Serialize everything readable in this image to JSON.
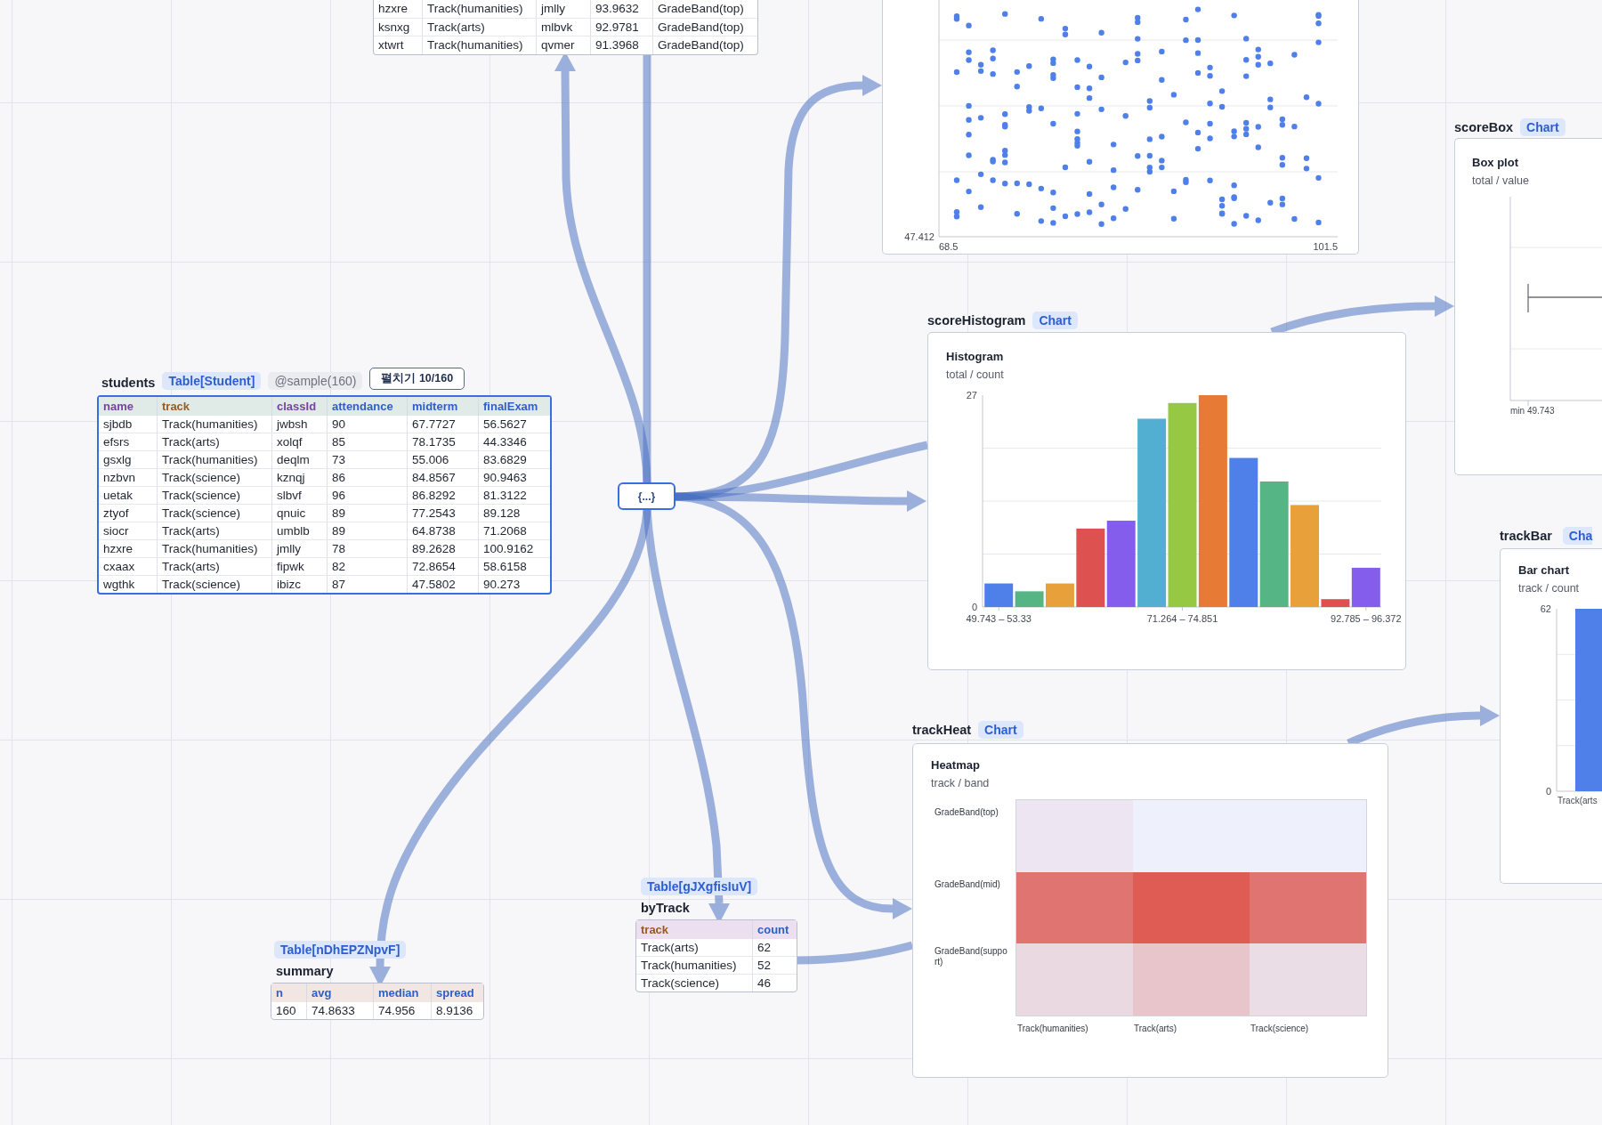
{
  "canvas": {
    "top_table": {
      "selected": false,
      "rows": [
        [
          "hzxre",
          "Track(humanities)",
          "jmlly",
          "93.9632",
          "GradeBand(top)"
        ],
        [
          "ksnxg",
          "Track(arts)",
          "mlbvk",
          "92.9781",
          "GradeBand(top)"
        ],
        [
          "xtwrt",
          "Track(humanities)",
          "qvmer",
          "91.3968",
          "GradeBand(top)"
        ]
      ]
    },
    "scatter_chart": {
      "y_min_label": "47.412",
      "x_min_label": "68.5",
      "x_max_label": "101.5"
    },
    "students": {
      "title": "students",
      "type_badge": "Table[Student]",
      "sample_badge": "@sample(160)",
      "expand_button": "펼치기 10/160",
      "selected": true,
      "columns": [
        {
          "label": "name",
          "kind": "string"
        },
        {
          "label": "track",
          "kind": "enum"
        },
        {
          "label": "classId",
          "kind": "string"
        },
        {
          "label": "attendance",
          "kind": "number"
        },
        {
          "label": "midterm",
          "kind": "number"
        },
        {
          "label": "finalExam",
          "kind": "number"
        }
      ],
      "rows": [
        [
          "sjbdb",
          "Track(humanities)",
          "jwbsh",
          "90",
          "67.7727",
          "56.5627"
        ],
        [
          "efsrs",
          "Track(arts)",
          "xolqf",
          "85",
          "78.1735",
          "44.3346"
        ],
        [
          "gsxlg",
          "Track(humanities)",
          "deqlm",
          "73",
          "55.006",
          "83.6829"
        ],
        [
          "nzbvn",
          "Track(science)",
          "kznqj",
          "86",
          "84.8567",
          "90.9463"
        ],
        [
          "uetak",
          "Track(science)",
          "slbvf",
          "96",
          "86.8292",
          "81.3122"
        ],
        [
          "ztyof",
          "Track(science)",
          "qnuic",
          "89",
          "77.2543",
          "89.128"
        ],
        [
          "siocr",
          "Track(arts)",
          "umblb",
          "89",
          "64.8738",
          "71.2068"
        ],
        [
          "hzxre",
          "Track(humanities)",
          "jmlly",
          "78",
          "89.2628",
          "100.9162"
        ],
        [
          "cxaax",
          "Track(arts)",
          "fipwk",
          "82",
          "72.8654",
          "58.6158"
        ],
        [
          "wgthk",
          "Track(science)",
          "ibizc",
          "87",
          "47.5802",
          "90.273"
        ]
      ]
    },
    "hub": {
      "label": "{...}"
    },
    "score_histogram": {
      "title": "scoreHistogram",
      "type_badge": "Chart",
      "subtitle": "total / count",
      "chart_data": {
        "type": "bar",
        "title": "Histogram",
        "categories": [
          "49.743 – 53.33",
          null,
          null,
          null,
          null,
          null,
          "71.264 – 74.851",
          null,
          null,
          null,
          null,
          null,
          "92.785 – 96.372"
        ],
        "series": [
          {
            "color": "#4f7fe9",
            "values": [
              3,
              null,
              null,
              null,
              null,
              null,
              null,
              null,
              19,
              null,
              null,
              null,
              null
            ]
          },
          {
            "color": "#55b585",
            "values": [
              null,
              2,
              null,
              null,
              null,
              null,
              null,
              null,
              null,
              16,
              null,
              null,
              null
            ]
          },
          {
            "color": "#e8a13a",
            "values": [
              null,
              null,
              3,
              null,
              null,
              null,
              null,
              null,
              null,
              null,
              13,
              null,
              null
            ]
          },
          {
            "color": "#dd5250",
            "values": [
              null,
              null,
              null,
              10,
              null,
              null,
              null,
              null,
              null,
              null,
              null,
              1,
              null
            ]
          },
          {
            "color": "#855ded",
            "values": [
              null,
              null,
              null,
              null,
              11,
              null,
              null,
              null,
              null,
              null,
              null,
              null,
              5
            ]
          },
          {
            "color": "#52afd2",
            "values": [
              null,
              null,
              null,
              null,
              null,
              24,
              null,
              null,
              null,
              null,
              null,
              null,
              null
            ]
          },
          {
            "color": "#96c843",
            "values": [
              null,
              null,
              null,
              null,
              null,
              null,
              26,
              null,
              null,
              null,
              null,
              null,
              null
            ]
          },
          {
            "color": "#e77a35",
            "values": [
              null,
              null,
              null,
              null,
              null,
              null,
              null,
              27,
              null,
              null,
              null,
              null,
              null
            ]
          }
        ],
        "ylim": [
          0,
          27
        ],
        "yticks": [
          0,
          27
        ]
      }
    },
    "score_box": {
      "title": "scoreBox",
      "type_badge": "Chart",
      "chart_title": "Box plot",
      "subtitle": "total / value",
      "min_label": "min 49.743"
    },
    "track_bar": {
      "title": "trackBar",
      "type_badge": "Cha",
      "subtitle": "track / count",
      "chart_data": {
        "type": "bar",
        "title": "Bar chart",
        "categories": [
          "Track(arts"
        ],
        "values": [
          62
        ],
        "ylim": [
          0,
          62
        ],
        "yticks": [
          0,
          62
        ]
      }
    },
    "track_heat": {
      "title": "trackHeat",
      "type_badge": "Chart",
      "chart_title": "Heatmap",
      "subtitle": "track / band",
      "row_labels": [
        "GradeBand(top)",
        "GradeBand(mid)",
        "GradeBand(support)"
      ],
      "column_labels": [
        "Track(humanities)",
        "Track(arts)",
        "Track(science)"
      ],
      "cells": [
        [
          {
            "color": "#ede6f2"
          },
          {
            "color": "#eef0fb"
          },
          {
            "color": "#eef0fb"
          }
        ],
        [
          {
            "color": "#e07470"
          },
          {
            "color": "#df5c55"
          },
          {
            "color": "#e07470"
          }
        ],
        [
          {
            "color": "#ead9e1"
          },
          {
            "color": "#e7c5cb"
          },
          {
            "color": "#eadde5"
          }
        ]
      ]
    },
    "by_track": {
      "type_badge": "Table[gJXgfisIuV]",
      "title": "byTrack",
      "selected": false,
      "columns": [
        {
          "label": "track",
          "kind": "enum"
        },
        {
          "label": "count",
          "kind": "number"
        }
      ],
      "rows": [
        [
          "Track(arts)",
          "62"
        ],
        [
          "Track(humanities)",
          "52"
        ],
        [
          "Track(science)",
          "46"
        ]
      ]
    },
    "summary": {
      "type_badge": "Table[nDhEPZNpvF]",
      "title": "summary",
      "selected": false,
      "columns": [
        {
          "label": "n",
          "kind": "number"
        },
        {
          "label": "avg",
          "kind": "number"
        },
        {
          "label": "median",
          "kind": "number"
        },
        {
          "label": "spread",
          "kind": "number"
        }
      ],
      "rows": [
        [
          "160",
          "74.8633",
          "74.956",
          "8.9136"
        ]
      ]
    }
  }
}
